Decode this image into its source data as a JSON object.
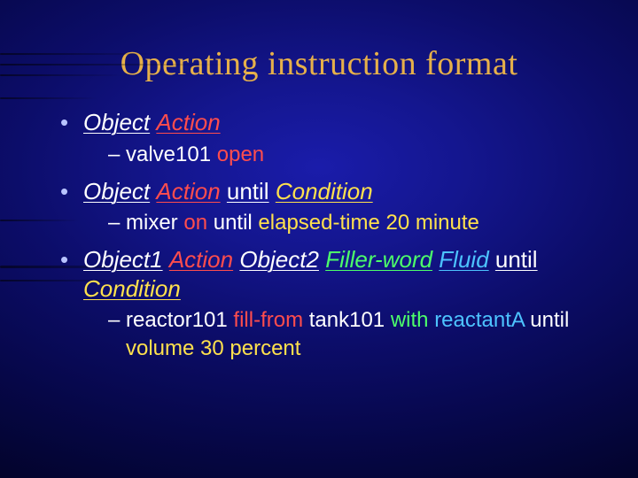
{
  "title": "Operating instruction format",
  "b1": {
    "object": "Object",
    "action": "Action",
    "sub": {
      "object": "valve101",
      "action": "open"
    }
  },
  "b2": {
    "object": "Object",
    "action": "Action",
    "until": "until",
    "condition": "Condition",
    "sub": {
      "object": "mixer",
      "action": "on",
      "until": "until",
      "condition": "elapsed-time 20 minute"
    }
  },
  "b3": {
    "object1": "Object1",
    "action": "Action",
    "object2": "Object2",
    "filler": "Filler-word",
    "fluid": "Fluid",
    "until": "until",
    "condition": "Condition",
    "sub": {
      "object1": "reactor101",
      "action": "fill-from",
      "object2": "tank101",
      "filler": "with",
      "fluid": "reactantA",
      "until": "until",
      "condition": "volume 30 percent"
    }
  }
}
